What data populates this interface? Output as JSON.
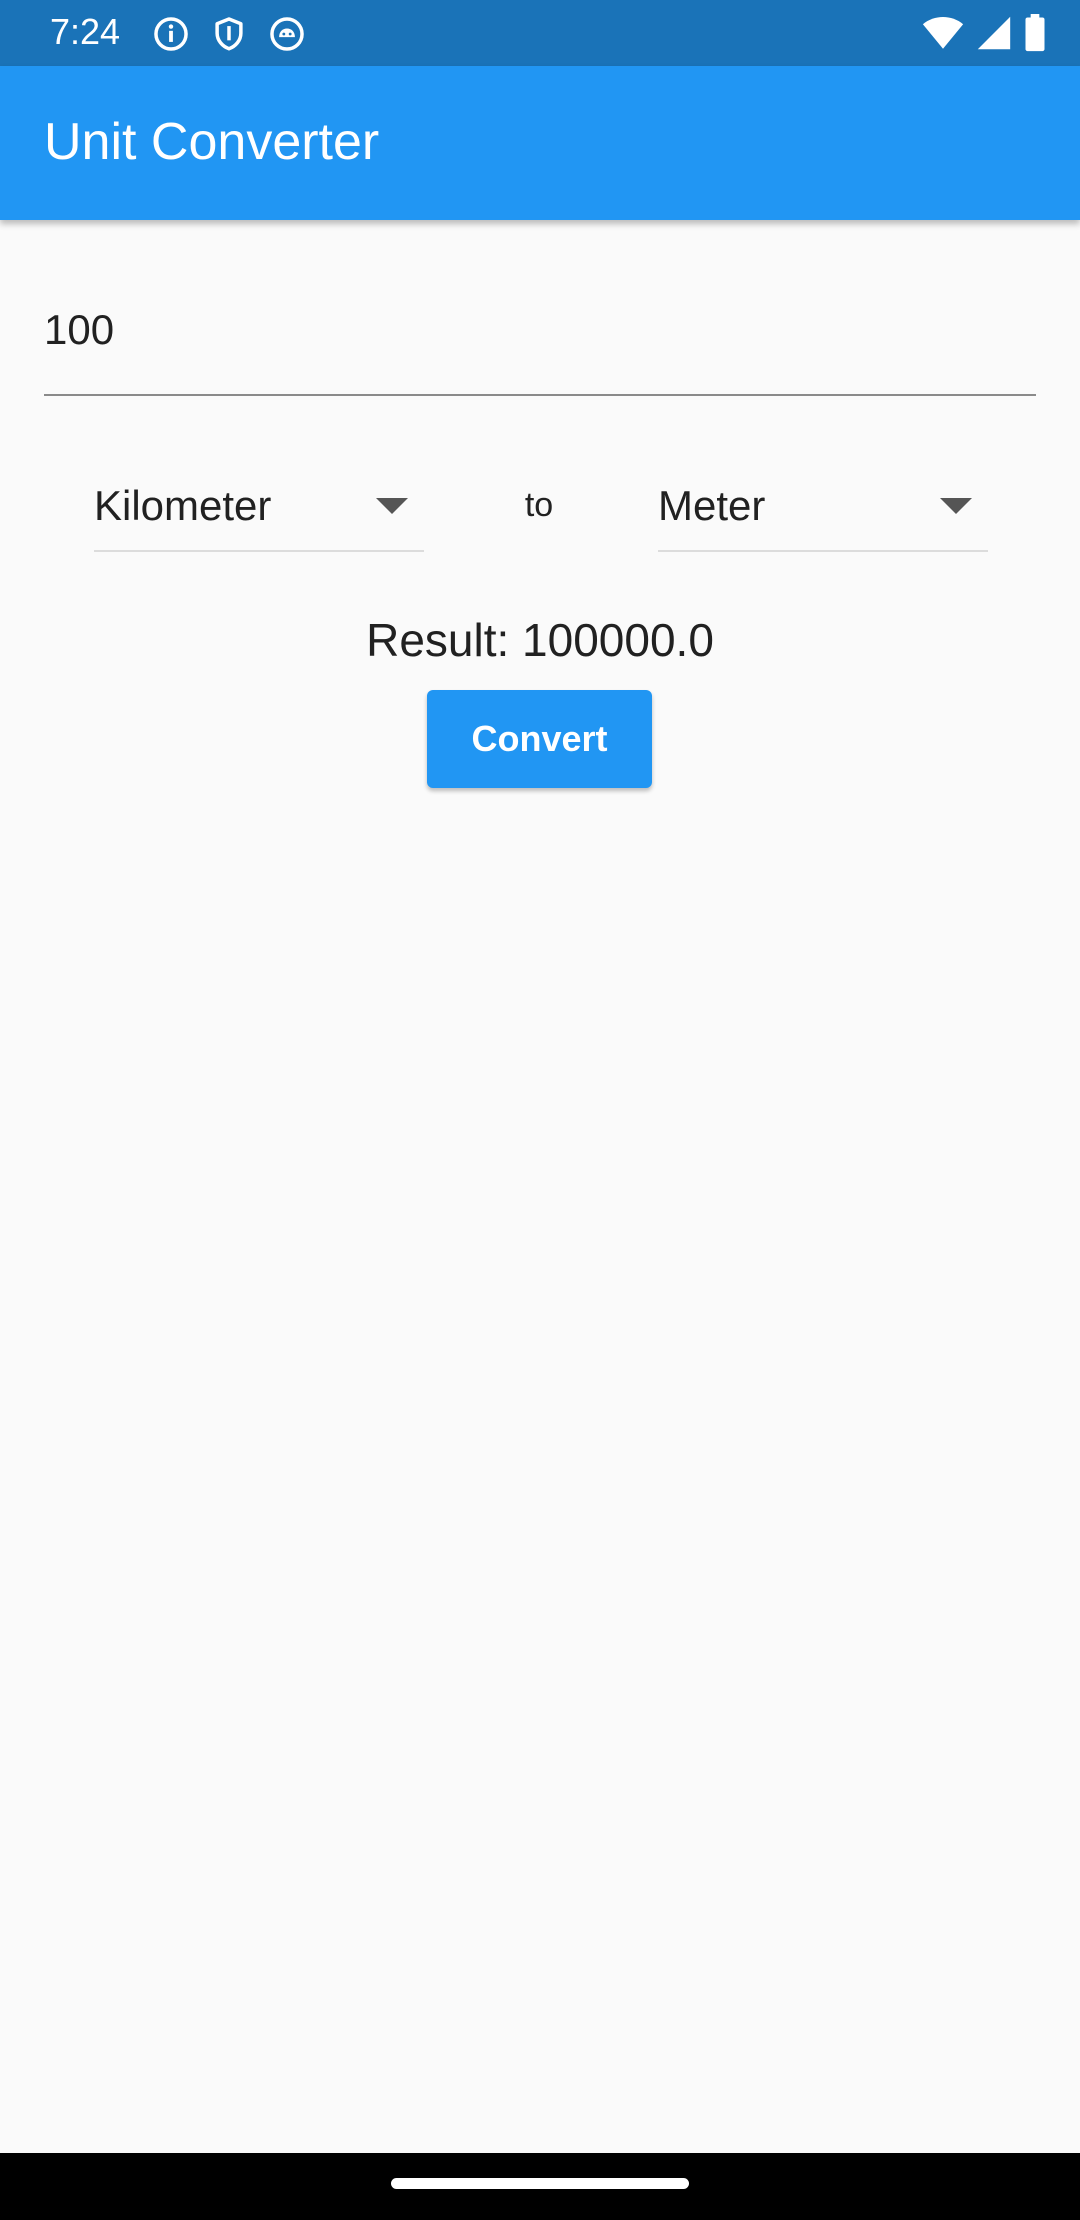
{
  "status_bar": {
    "time": "7:24",
    "left_icons": [
      "info-icon",
      "shield-icon",
      "android-debug-icon"
    ],
    "right_icons": [
      "wifi-icon",
      "cell-signal-icon",
      "battery-icon"
    ]
  },
  "app_bar": {
    "title": "Unit Converter",
    "color": "#2196f3"
  },
  "converter": {
    "input_value": "100",
    "from_unit": "Kilometer",
    "to_label": "to",
    "to_unit": "Meter",
    "result_text": "Result: 100000.0",
    "convert_label": "Convert"
  },
  "colors": {
    "status_bar": "#1a73b8",
    "accent": "#2196f3",
    "background": "#fafafa"
  }
}
